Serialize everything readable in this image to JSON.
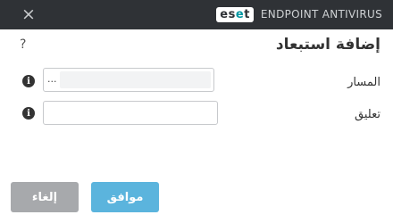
{
  "window": {
    "close_icon": "×",
    "logo": {
      "part1": "es",
      "accent": "e",
      "part2": "t"
    },
    "product_name": "ENDPOINT ANTIVIRUS"
  },
  "dialog": {
    "help_icon": "?",
    "title": "إضافة استبعاد",
    "path_label": "المسار",
    "path_value": "",
    "browse_label": "...",
    "comment_label": "تعليق",
    "comment_value": ""
  },
  "buttons": {
    "ok_label": "موافق",
    "cancel_label": "إلغاء"
  },
  "colors": {
    "titlebar": "#2f3236",
    "logo_accent": "#0096a1",
    "ok_button": "#5bb4dd",
    "cancel_button": "#a7a9ac"
  }
}
